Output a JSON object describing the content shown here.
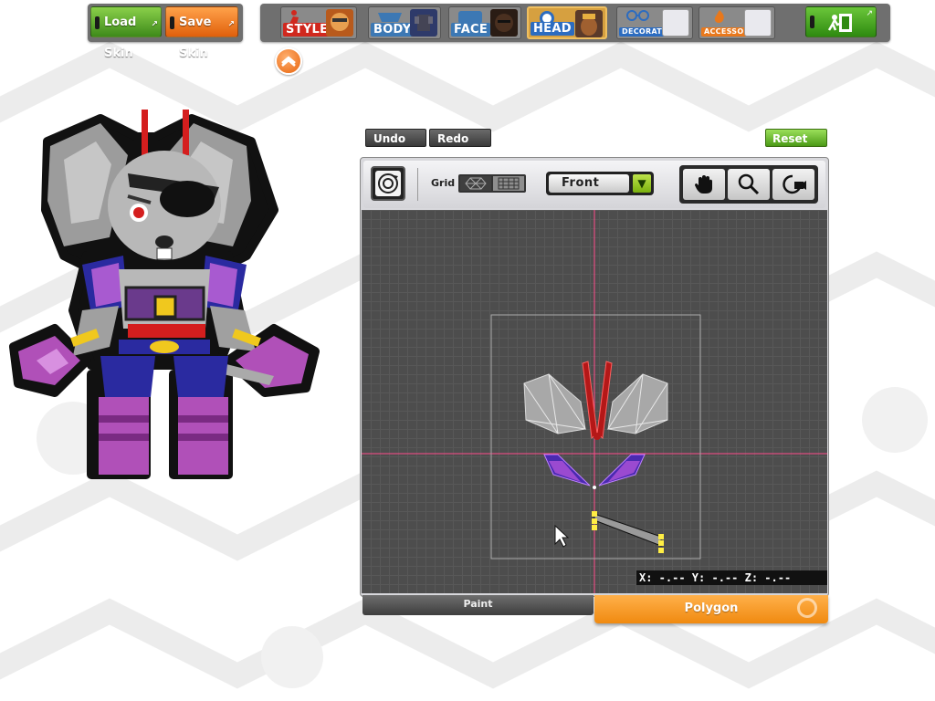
{
  "colors": {
    "load_skin": "#5aa82a",
    "save_skin": "#f07a1c",
    "style": "#d0281e",
    "body": "#3c78b4",
    "face": "#3c78b4",
    "head": "#2c6cc0",
    "decoration": "#2c6cc0",
    "accessory": "#e8781c",
    "reset": "#6cc02a",
    "polygon_tab": "#f59a1c"
  },
  "top_bar": {
    "load_skin": "Load Skin",
    "save_skin": "Save Skin",
    "categories": [
      {
        "label": "STYLE",
        "icon": "style-icon"
      },
      {
        "label": "BODY",
        "icon": "body-icon"
      },
      {
        "label": "FACE",
        "icon": "face-icon"
      },
      {
        "label": "HEAD",
        "icon": "head-icon",
        "selected": true
      },
      {
        "label": "DECORATION",
        "icon": "glasses-icon"
      },
      {
        "label": "ACCESSORY",
        "icon": "flame-icon"
      }
    ],
    "exit_icon": "exit-door-icon"
  },
  "editor": {
    "undo": "Undo",
    "redo": "Redo",
    "reset": "Reset",
    "grid_label": "Grid",
    "view_selected": "Front",
    "tools": [
      "hand-icon",
      "magnifier-icon",
      "camera-rotate-icon"
    ],
    "coords": "X: -.-- Y: -.-- Z: -.--"
  },
  "tabs": {
    "paint": "Paint",
    "polygon": "Polygon",
    "active": "Polygon"
  }
}
